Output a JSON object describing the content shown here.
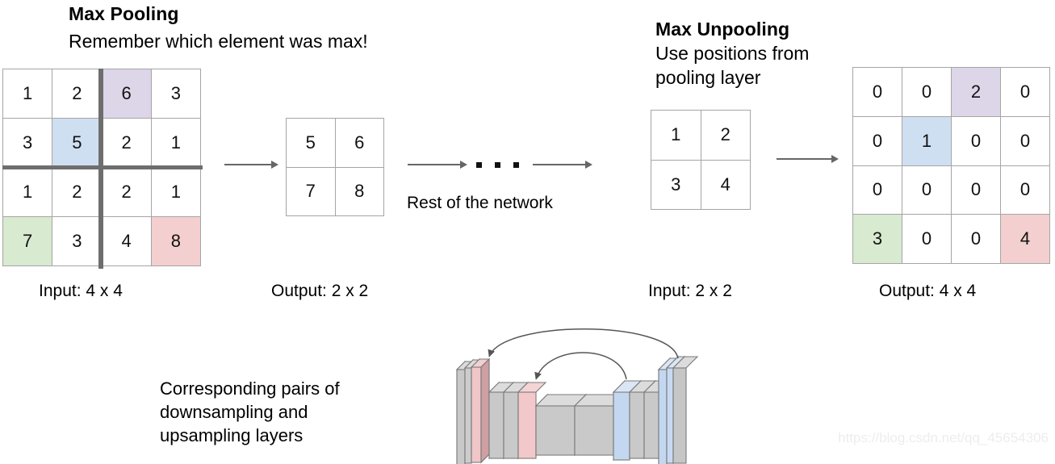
{
  "pooling": {
    "title": "Max Pooling",
    "subtitle": "Remember which element was max!",
    "input_caption": "Input: 4 x 4",
    "output_caption": "Output: 2 x 2"
  },
  "unpooling": {
    "title": "Max Unpooling",
    "subtitle_line1": "Use positions from",
    "subtitle_line2": "pooling layer",
    "input_caption": "Input: 2 x 2",
    "output_caption": "Output: 4 x 4"
  },
  "middle": {
    "rest_of_network_label": "Rest of the network",
    "ellipsis_dots": 3
  },
  "network": {
    "label_line1": "Corresponding pairs of",
    "label_line2": "downsampling and",
    "label_line3": "upsampling layers"
  },
  "watermark": {
    "text": "https://blog.csdn.net/qq_45654306"
  },
  "colors": {
    "highlight_purple": "#ddd5e8",
    "highlight_blue": "#cfdff2",
    "highlight_green": "#d8ead0",
    "highlight_pink": "#f4cfcf",
    "cell_border": "#a5a5a5",
    "thick_divider": "#6e6e6e",
    "arrow": "#666666",
    "watermark": "#ededed",
    "block_gray": "#c8c8c8",
    "block_pink": "#f2c9cc",
    "block_blue": "#c2d6ef"
  },
  "chart_data": {
    "type": "table",
    "title": "Max Pooling / Max Unpooling with switch positions",
    "grids": [
      {
        "name": "pooling_input",
        "caption": "Input: 4 x 4",
        "rows": 4,
        "cols": 4,
        "values": [
          [
            1,
            2,
            6,
            3
          ],
          [
            3,
            5,
            2,
            1
          ],
          [
            1,
            2,
            2,
            1
          ],
          [
            7,
            3,
            4,
            8
          ]
        ],
        "highlights": [
          {
            "row": 0,
            "col": 2,
            "color": "#ddd5e8"
          },
          {
            "row": 1,
            "col": 1,
            "color": "#cfdff2"
          },
          {
            "row": 3,
            "col": 0,
            "color": "#d8ead0"
          },
          {
            "row": 3,
            "col": 3,
            "color": "#f4cfcf"
          }
        ],
        "quadrant_dividers": true
      },
      {
        "name": "pooling_output",
        "caption": "Output: 2 x 2",
        "rows": 2,
        "cols": 2,
        "values": [
          [
            5,
            6
          ],
          [
            7,
            8
          ]
        ],
        "highlights": [],
        "quadrant_dividers": false
      },
      {
        "name": "unpooling_input",
        "caption": "Input: 2 x 2",
        "rows": 2,
        "cols": 2,
        "values": [
          [
            1,
            2
          ],
          [
            3,
            4
          ]
        ],
        "highlights": [],
        "quadrant_dividers": false
      },
      {
        "name": "unpooling_output",
        "caption": "Output: 4 x 4",
        "rows": 4,
        "cols": 4,
        "values": [
          [
            0,
            0,
            2,
            0
          ],
          [
            0,
            1,
            0,
            0
          ],
          [
            0,
            0,
            0,
            0
          ],
          [
            3,
            0,
            0,
            4
          ]
        ],
        "highlights": [
          {
            "row": 0,
            "col": 2,
            "color": "#ddd5e8"
          },
          {
            "row": 1,
            "col": 1,
            "color": "#cfdff2"
          },
          {
            "row": 3,
            "col": 0,
            "color": "#d8ead0"
          },
          {
            "row": 3,
            "col": 3,
            "color": "#f4cfcf"
          }
        ],
        "quadrant_dividers": false
      }
    ]
  },
  "cells": {
    "in4": {
      "r0c0": "1",
      "r0c1": "2",
      "r0c2": "6",
      "r0c3": "3",
      "r1c0": "3",
      "r1c1": "5",
      "r1c2": "2",
      "r1c3": "1",
      "r2c0": "1",
      "r2c1": "2",
      "r2c2": "2",
      "r2c3": "1",
      "r3c0": "7",
      "r3c1": "3",
      "r3c2": "4",
      "r3c3": "8"
    },
    "out2": {
      "r0c0": "5",
      "r0c1": "6",
      "r1c0": "7",
      "r1c1": "8"
    },
    "in2": {
      "r0c0": "1",
      "r0c1": "2",
      "r1c0": "3",
      "r1c1": "4"
    },
    "out4": {
      "r0c0": "0",
      "r0c1": "0",
      "r0c2": "2",
      "r0c3": "0",
      "r1c0": "0",
      "r1c1": "1",
      "r1c2": "0",
      "r1c3": "0",
      "r2c0": "0",
      "r2c1": "0",
      "r2c2": "0",
      "r2c3": "0",
      "r3c0": "3",
      "r3c1": "0",
      "r3c2": "0",
      "r3c3": "4"
    }
  }
}
